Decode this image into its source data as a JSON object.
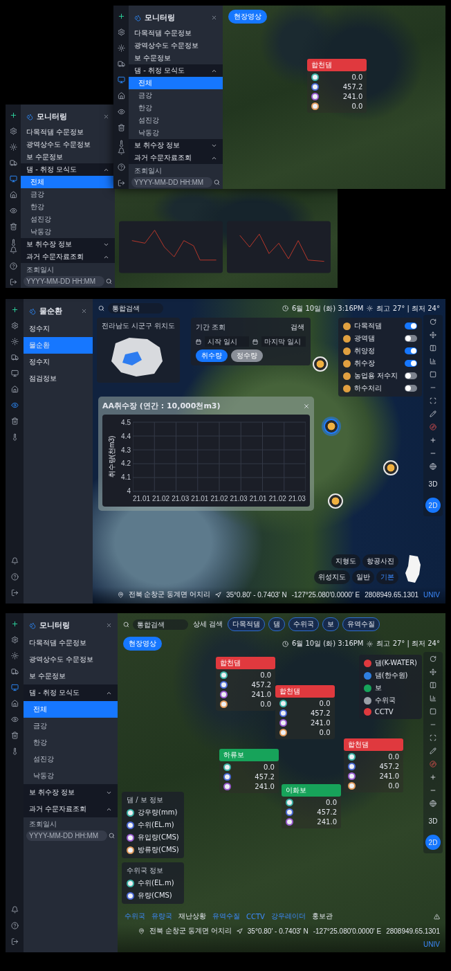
{
  "preview": {
    "front": {
      "rail": [
        {
          "selected": false
        },
        {
          "selected": false
        },
        {
          "selected": false
        },
        {
          "selected": false
        },
        {
          "selected": true
        },
        {
          "selected": false
        },
        {
          "selected": false
        },
        {
          "selected": false
        },
        {
          "selected": false
        }
      ],
      "sidebar": {
        "title": "모니터링",
        "items": [
          {
            "kind": "link",
            "label": "다목적댐 수문정보"
          },
          {
            "kind": "link",
            "label": "광역상수도 수문정보"
          },
          {
            "kind": "link",
            "label": "보 수문정보"
          },
          {
            "kind": "group",
            "label": "댐 - 취정 모식도",
            "expanded": true,
            "children": [
              {
                "label": "전체",
                "selected": true
              },
              {
                "label": "금강",
                "selected": false
              },
              {
                "label": "한강",
                "selected": false
              },
              {
                "label": "섬진강",
                "selected": false
              },
              {
                "label": "낙동강",
                "selected": false
              }
            ]
          },
          {
            "kind": "group",
            "label": "보 취수장 정보",
            "expanded": false
          },
          {
            "kind": "group",
            "label": "과거 수문자료조회",
            "expanded": true,
            "field_label": "조회일시",
            "placeholder": "YYYY-MM-DD HH:MM"
          }
        ]
      },
      "live_button": "현장영상",
      "marker": {
        "name": "합천댐",
        "color": "#e0393e",
        "values": [
          "0.0",
          "457.2",
          "241.0",
          "0.0"
        ]
      }
    },
    "back": {
      "rail": [
        {
          "selected": false
        },
        {
          "selected": false
        },
        {
          "selected": false
        },
        {
          "selected": false
        },
        {
          "selected": true
        },
        {
          "selected": false
        },
        {
          "selected": false
        },
        {
          "selected": false
        },
        {
          "selected": false
        }
      ],
      "sidebar": {
        "title": "모니터링",
        "items": [
          {
            "kind": "link",
            "label": "다목적댐 수문정보"
          },
          {
            "kind": "link",
            "label": "광역상수도 수문정보"
          },
          {
            "kind": "link",
            "label": "보 수문정보"
          },
          {
            "kind": "group",
            "label": "댐 - 취정 모식도",
            "expanded": true,
            "children": [
              {
                "label": "전체",
                "selected": true
              },
              {
                "label": "금강",
                "selected": false
              },
              {
                "label": "한강",
                "selected": false
              },
              {
                "label": "섬진강",
                "selected": false
              },
              {
                "label": "낙동강",
                "selected": false
              }
            ]
          },
          {
            "kind": "group",
            "label": "보 취수장 정보",
            "expanded": false
          },
          {
            "kind": "group",
            "label": "과거 수문자료조회",
            "expanded": true,
            "field_label": "조회일시",
            "placeholder": "YYYY-MM-DD HH:MM"
          }
        ]
      }
    }
  },
  "water_cycle_screen": {
    "rail": [
      {
        "selected": false
      },
      {
        "selected": false
      },
      {
        "selected": false
      },
      {
        "selected": false
      },
      {
        "selected": false
      },
      {
        "selected": false
      },
      {
        "selected": true
      },
      {
        "selected": false
      },
      {
        "selected": false
      }
    ],
    "sidebar": {
      "title": "물순환",
      "items": [
        {
          "label": "정수지",
          "selected": false
        },
        {
          "label": "물순환",
          "selected": true
        },
        {
          "label": "정수지",
          "selected": false
        },
        {
          "label": "점검정보",
          "selected": false
        }
      ]
    },
    "search": {
      "placeholder": "통합검색"
    },
    "clock": "6월 10일 (화) 3:16PM",
    "weather": "최고 27° | 최저 24°",
    "minimap": {
      "title": "전라남도 시군구 위치도"
    },
    "period": {
      "title": "기간 조회",
      "start_placeholder": "시작 일시",
      "end_placeholder": "마지막 일시",
      "search_button": "검색",
      "modes": [
        {
          "label": "취수량",
          "selected": true
        },
        {
          "label": "정수량",
          "selected": false
        }
      ]
    },
    "layers": [
      {
        "label": "다목적댐",
        "on": true
      },
      {
        "label": "광역댐",
        "on": false
      },
      {
        "label": "취양정",
        "on": true
      },
      {
        "label": "취수장",
        "on": true
      },
      {
        "label": "농업용 저수지",
        "on": false
      },
      {
        "label": "하수처리",
        "on": false
      }
    ],
    "chart": {
      "title": "AA취수장 (연간 : 10,000천m3)",
      "ylabel": "취수량(천m3)",
      "yticks": [
        "4.5",
        "4.4",
        "4.3",
        "4.2",
        "4.1",
        "4"
      ],
      "xticks": [
        "21.01",
        "21.02",
        "21.03",
        "21.01",
        "21.02",
        "21.03",
        "21.01",
        "21.02",
        "21.03"
      ]
    },
    "dam_markers": [
      {
        "selected": false
      },
      {
        "selected": true
      },
      {
        "selected": false
      },
      {
        "selected": false
      }
    ],
    "view_modes": [
      {
        "label": "3D",
        "selected": false
      },
      {
        "label": "2D",
        "selected": true
      }
    ],
    "basemaps": [
      {
        "label": "지형도",
        "selected": false
      },
      {
        "label": "항공사진",
        "selected": false
      },
      {
        "label": "위성지도",
        "selected": false
      },
      {
        "label": "일반",
        "selected": false
      },
      {
        "label": "기본",
        "selected": true
      }
    ],
    "status": {
      "location": "전북 순창군 동계면 어치리",
      "latitude": "35°0.80' - 0.7403' N",
      "longitude": "-127°25.080'0.0000' E",
      "code": "2808949.65.1301",
      "unit": "UNIV"
    }
  },
  "monitoring_screen": {
    "rail": [
      {
        "selected": false
      },
      {
        "selected": false
      },
      {
        "selected": false
      },
      {
        "selected": false
      },
      {
        "selected": true
      },
      {
        "selected": false
      },
      {
        "selected": false
      },
      {
        "selected": false
      },
      {
        "selected": false
      }
    ],
    "sidebar": {
      "title": "모니터링",
      "items": [
        {
          "kind": "link",
          "label": "다목적댐 수문정보"
        },
        {
          "kind": "link",
          "label": "광역상수도 수문정보"
        },
        {
          "kind": "link",
          "label": "보 수문정보"
        },
        {
          "kind": "group",
          "label": "댐 - 취정 모식도",
          "expanded": true,
          "children": [
            {
              "label": "전체",
              "selected": true
            },
            {
              "label": "금강",
              "selected": false
            },
            {
              "label": "한강",
              "selected": false
            },
            {
              "label": "섬진강",
              "selected": false
            },
            {
              "label": "낙동강",
              "selected": false
            }
          ]
        },
        {
          "kind": "group",
          "label": "보 취수장 정보",
          "expanded": false
        },
        {
          "kind": "group",
          "label": "과거 수문자료조회",
          "expanded": true,
          "field_label": "조회일시",
          "placeholder": "YYYY-MM-DD HH:MM"
        }
      ]
    },
    "search": {
      "placeholder": "통합검색"
    },
    "detail_search": "상세 검색",
    "chips": [
      "다목적댐",
      "댐",
      "수위국",
      "보",
      "유역수질"
    ],
    "live_button": "현장영상",
    "clock": "6월 10일 (화) 3:16PM",
    "weather": "최고 27° | 최저 24°",
    "legend": [
      {
        "label": "댐(K-WATER)",
        "color": "#e0393e"
      },
      {
        "label": "댐(한수원)",
        "color": "#2f7fe0"
      },
      {
        "label": "보",
        "color": "#17a35a"
      },
      {
        "label": "수위국",
        "color": "#9aa0a8"
      },
      {
        "label": "CCTV",
        "color": "#e0393e"
      }
    ],
    "markers": [
      {
        "name": "합천댐",
        "color": "#e0393e",
        "values": [
          "0.0",
          "457.2",
          "241.0",
          "0.0"
        ]
      },
      {
        "name": "합천댐",
        "color": "#e0393e",
        "values": [
          "0.0",
          "457.2",
          "241.0",
          "0.0"
        ]
      },
      {
        "name": "하류보",
        "color": "#17a35a",
        "values": [
          "0.0",
          "457.2",
          "241.0"
        ]
      },
      {
        "name": "이화보",
        "color": "#17a35a",
        "values": [
          "0.0",
          "457.2",
          "241.0"
        ]
      },
      {
        "name": "합천댐",
        "color": "#e0393e",
        "values": [
          "0.0",
          "457.2",
          "241.0",
          "0.0"
        ]
      }
    ],
    "info_boxes": [
      {
        "title": "댐 / 보 정보",
        "items": [
          "강우량(mm)",
          "수위(EL.m)",
          "유입량(CMS)",
          "방류량(CMS)"
        ]
      },
      {
        "title": "수위국 정보",
        "items": [
          "수위(EL.m)",
          "유량(CMS)"
        ]
      }
    ],
    "bottom_tabs": [
      {
        "label": "수위국",
        "on": true
      },
      {
        "label": "유량국",
        "on": true
      },
      {
        "label": "재난상황",
        "on": false
      },
      {
        "label": "유역수질",
        "on": true
      },
      {
        "label": "CCTV",
        "on": true
      },
      {
        "label": "강우레이더",
        "on": true
      },
      {
        "label": "홍보관",
        "on": false
      }
    ],
    "view_modes": [
      {
        "label": "3D",
        "selected": false
      },
      {
        "label": "2D",
        "selected": true
      }
    ],
    "status": {
      "location": "전북 순창군 동계면 어치리",
      "latitude": "35°0.80' - 0.7403' N",
      "longitude": "-127°25.080'0.0000' E",
      "code": "2808949.65.1301",
      "unit": "UNIV"
    }
  }
}
